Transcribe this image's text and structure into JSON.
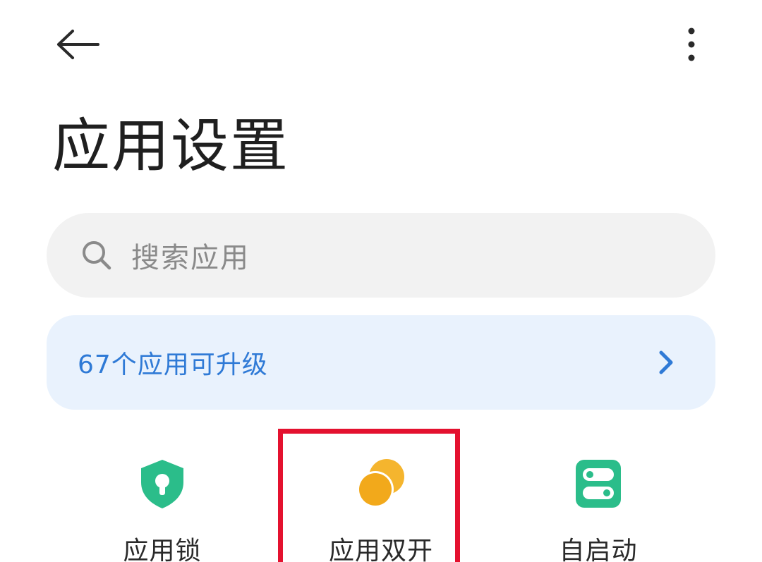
{
  "header": {
    "back_icon": "arrow-left-icon",
    "more_icon": "more-vertical-icon",
    "title": "应用设置"
  },
  "search": {
    "placeholder": "搜索应用",
    "icon": "search-icon"
  },
  "upgrade_banner": {
    "text": "67个应用可升级",
    "icon": "chevron-right-icon",
    "color": "#2f7ad6",
    "background": "#e9f2fd"
  },
  "features": [
    {
      "label": "应用锁",
      "icon": "shield-lock-icon",
      "color": "#2bbd8a"
    },
    {
      "label": "应用双开",
      "icon": "dual-circles-icon",
      "color": "#f2a91b"
    },
    {
      "label": "自启动",
      "icon": "toggle-switches-icon",
      "color": "#2bbd8a"
    }
  ],
  "highlight": {
    "color": "#e4112f",
    "target": "应用双开"
  }
}
